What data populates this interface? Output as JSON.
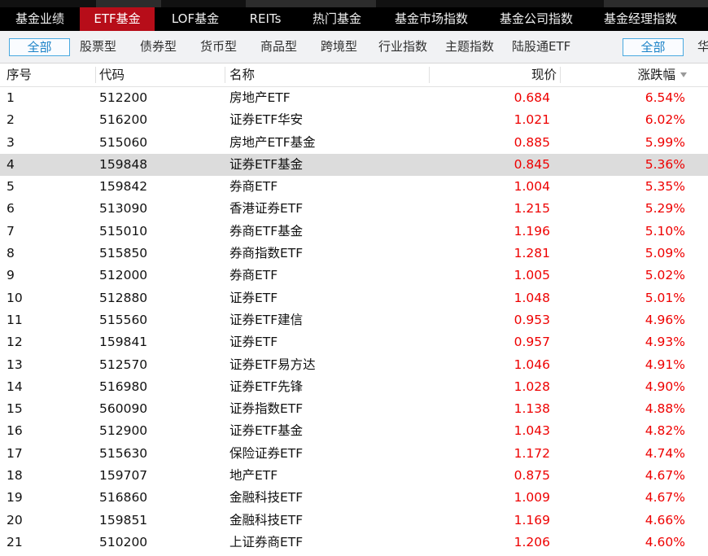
{
  "main_tabs": [
    {
      "label": "基金业绩",
      "active": false
    },
    {
      "label": "ETF基金",
      "active": true
    },
    {
      "label": "LOF基金",
      "active": false
    },
    {
      "label": "REITs",
      "active": false
    },
    {
      "label": "热门基金",
      "active": false
    },
    {
      "label": "基金市场指数",
      "active": false
    },
    {
      "label": "基金公司指数",
      "active": false
    },
    {
      "label": "基金经理指数",
      "active": false
    }
  ],
  "filters": {
    "categories": [
      "全部",
      "股票型",
      "债券型",
      "货币型",
      "商品型",
      "跨境型",
      "行业指数",
      "主题指数",
      "陆股通ETF"
    ],
    "selected_category": "全部",
    "right_selected": "全部",
    "right_truncated": "华"
  },
  "table": {
    "headers": {
      "no": "序号",
      "code": "代码",
      "name": "名称",
      "price": "现价",
      "change": "涨跌幅"
    },
    "sort_column": "change",
    "sort_direction": "desc",
    "selected_row": "4",
    "rows": [
      {
        "no": "1",
        "code": "512200",
        "name": "房地产ETF",
        "price": "0.684",
        "change": "6.54%"
      },
      {
        "no": "2",
        "code": "516200",
        "name": "证券ETF华安",
        "price": "1.021",
        "change": "6.02%"
      },
      {
        "no": "3",
        "code": "515060",
        "name": "房地产ETF基金",
        "price": "0.885",
        "change": "5.99%"
      },
      {
        "no": "4",
        "code": "159848",
        "name": "证券ETF基金",
        "price": "0.845",
        "change": "5.36%"
      },
      {
        "no": "5",
        "code": "159842",
        "name": "券商ETF",
        "price": "1.004",
        "change": "5.35%"
      },
      {
        "no": "6",
        "code": "513090",
        "name": "香港证券ETF",
        "price": "1.215",
        "change": "5.29%"
      },
      {
        "no": "7",
        "code": "515010",
        "name": "券商ETF基金",
        "price": "1.196",
        "change": "5.10%"
      },
      {
        "no": "8",
        "code": "515850",
        "name": "券商指数ETF",
        "price": "1.281",
        "change": "5.09%"
      },
      {
        "no": "9",
        "code": "512000",
        "name": "券商ETF",
        "price": "1.005",
        "change": "5.02%"
      },
      {
        "no": "10",
        "code": "512880",
        "name": "证券ETF",
        "price": "1.048",
        "change": "5.01%"
      },
      {
        "no": "11",
        "code": "515560",
        "name": "证券ETF建信",
        "price": "0.953",
        "change": "4.96%"
      },
      {
        "no": "12",
        "code": "159841",
        "name": "证券ETF",
        "price": "0.957",
        "change": "4.93%"
      },
      {
        "no": "13",
        "code": "512570",
        "name": "证券ETF易方达",
        "price": "1.046",
        "change": "4.91%"
      },
      {
        "no": "14",
        "code": "516980",
        "name": "证券ETF先锋",
        "price": "1.028",
        "change": "4.90%"
      },
      {
        "no": "15",
        "code": "560090",
        "name": "证券指数ETF",
        "price": "1.138",
        "change": "4.88%"
      },
      {
        "no": "16",
        "code": "512900",
        "name": "证券ETF基金",
        "price": "1.043",
        "change": "4.82%"
      },
      {
        "no": "17",
        "code": "515630",
        "name": "保险证券ETF",
        "price": "1.172",
        "change": "4.74%"
      },
      {
        "no": "18",
        "code": "159707",
        "name": "地产ETF",
        "price": "0.875",
        "change": "4.67%"
      },
      {
        "no": "19",
        "code": "516860",
        "name": "金融科技ETF",
        "price": "1.009",
        "change": "4.67%"
      },
      {
        "no": "20",
        "code": "159851",
        "name": "金融科技ETF",
        "price": "1.169",
        "change": "4.66%"
      },
      {
        "no": "21",
        "code": "510200",
        "name": "上证券商ETF",
        "price": "1.206",
        "change": "4.60%"
      }
    ]
  },
  "colors": {
    "active_tab_bg": "#b70d19",
    "rise_color": "#ee0000",
    "selected_filter_color": "#1a82c7",
    "selected_row_bg": "#dcdcdc"
  }
}
